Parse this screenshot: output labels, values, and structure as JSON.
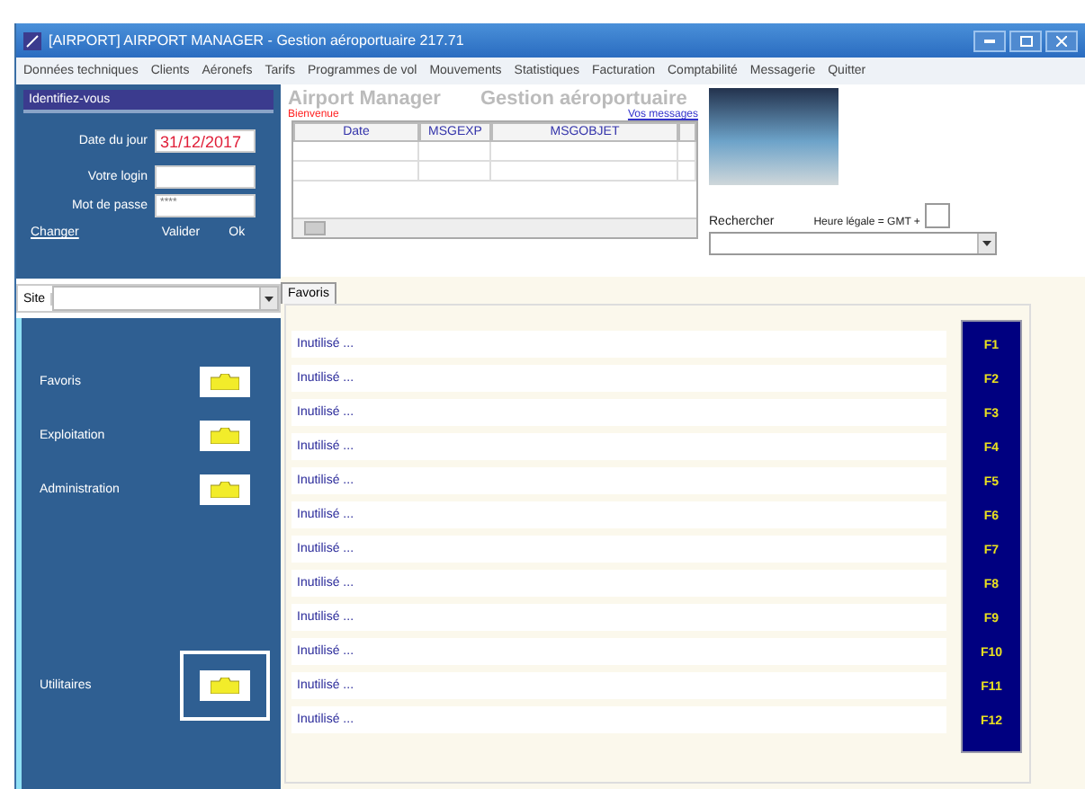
{
  "window": {
    "title": "[AIRPORT] AIRPORT MANAGER - Gestion aéroportuaire 217.71"
  },
  "menu": [
    "Données techniques",
    "Clients",
    "Aéronefs",
    "Tarifs",
    "Programmes de vol",
    "Mouvements",
    "Statistiques",
    "Facturation",
    "Comptabilité",
    "Messagerie",
    "Quitter"
  ],
  "login": {
    "header": "Identifiez-vous",
    "date_label": "Date du jour",
    "date_value": "31/12/2017",
    "login_label": "Votre login",
    "password_label": "Mot de passe",
    "password_value": "****",
    "change_link": "Changer",
    "validate_label": "Valider",
    "ok_button": "Ok"
  },
  "site": {
    "label": "Site"
  },
  "sidebar": {
    "items": [
      {
        "label": "Favoris",
        "selected": false
      },
      {
        "label": "Exploitation",
        "selected": false
      },
      {
        "label": "Administration",
        "selected": false
      },
      {
        "label": "Utilitaires",
        "selected": true
      }
    ]
  },
  "header": {
    "app_name": "Airport Manager",
    "subtitle": "Gestion aéroportuaire",
    "welcome": "Bienvenue",
    "messages_link": "Vos messages"
  },
  "messages_table": {
    "columns": [
      "Date",
      "MSGEXP",
      "MSGOBJET"
    ]
  },
  "search": {
    "label": "Rechercher",
    "gmt_label": "Heure légale = GMT +"
  },
  "tabs": [
    {
      "label": "Favoris",
      "selected": true
    }
  ],
  "favorites": [
    {
      "label": "Inutilisé ...",
      "key": "F1"
    },
    {
      "label": "Inutilisé ...",
      "key": "F2"
    },
    {
      "label": "Inutilisé ...",
      "key": "F3"
    },
    {
      "label": "Inutilisé ...",
      "key": "F4"
    },
    {
      "label": "Inutilisé ...",
      "key": "F5"
    },
    {
      "label": "Inutilisé ...",
      "key": "F6"
    },
    {
      "label": "Inutilisé ...",
      "key": "F7"
    },
    {
      "label": "Inutilisé ...",
      "key": "F8"
    },
    {
      "label": "Inutilisé ...",
      "key": "F9"
    },
    {
      "label": "Inutilisé ...",
      "key": "F10"
    },
    {
      "label": "Inutilisé ...",
      "key": "F11"
    },
    {
      "label": "Inutilisé ...",
      "key": "F12"
    }
  ]
}
